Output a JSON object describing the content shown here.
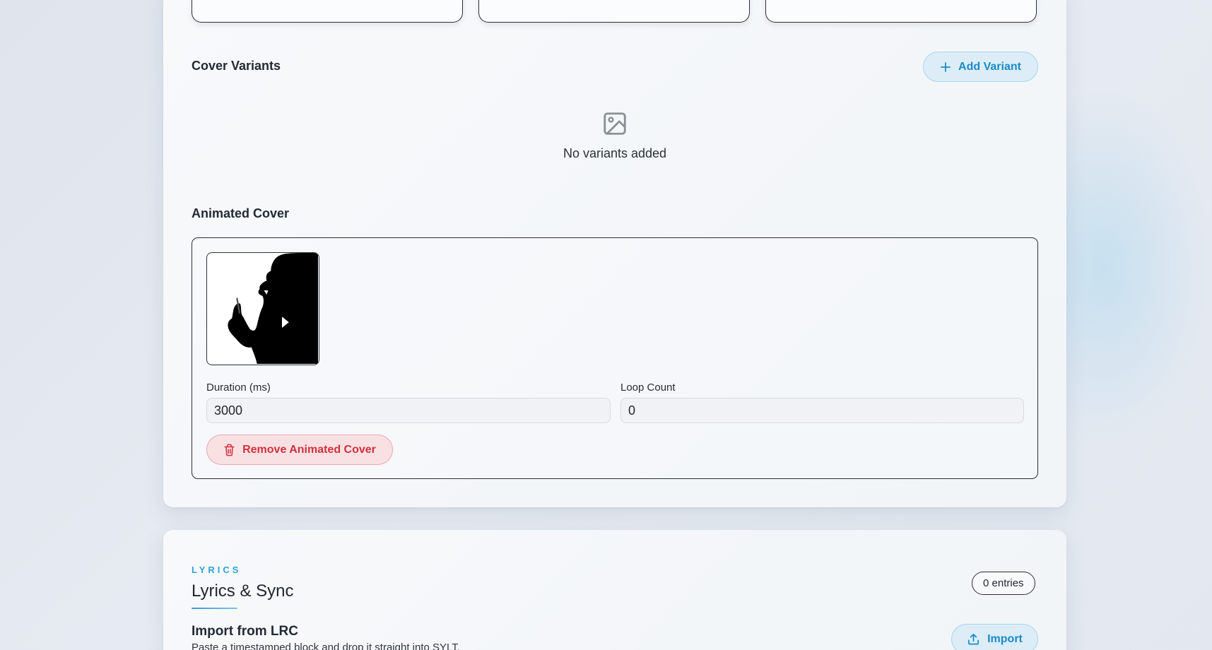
{
  "cover_variants": {
    "title": "Cover Variants",
    "add_button": "Add Variant",
    "empty_text": "No variants added"
  },
  "animated_cover": {
    "title": "Animated Cover",
    "duration_label": "Duration (ms)",
    "duration_value": "3000",
    "loop_label": "Loop Count",
    "loop_value": "0",
    "remove_button": "Remove Animated Cover"
  },
  "lyrics": {
    "eyebrow": "LYRICS",
    "title": "Lyrics & Sync",
    "entries_badge": "0 entries",
    "import_title": "Import from LRC",
    "import_desc": "Paste a timestamped block and drop it straight into SYLT.",
    "import_button": "Import"
  },
  "icons": {
    "add": "plus-icon",
    "empty": "image-icon",
    "remove": "trash-icon",
    "import": "upload-icon"
  },
  "colors": {
    "accent": "#1b8ac8",
    "danger": "#d2303f"
  }
}
